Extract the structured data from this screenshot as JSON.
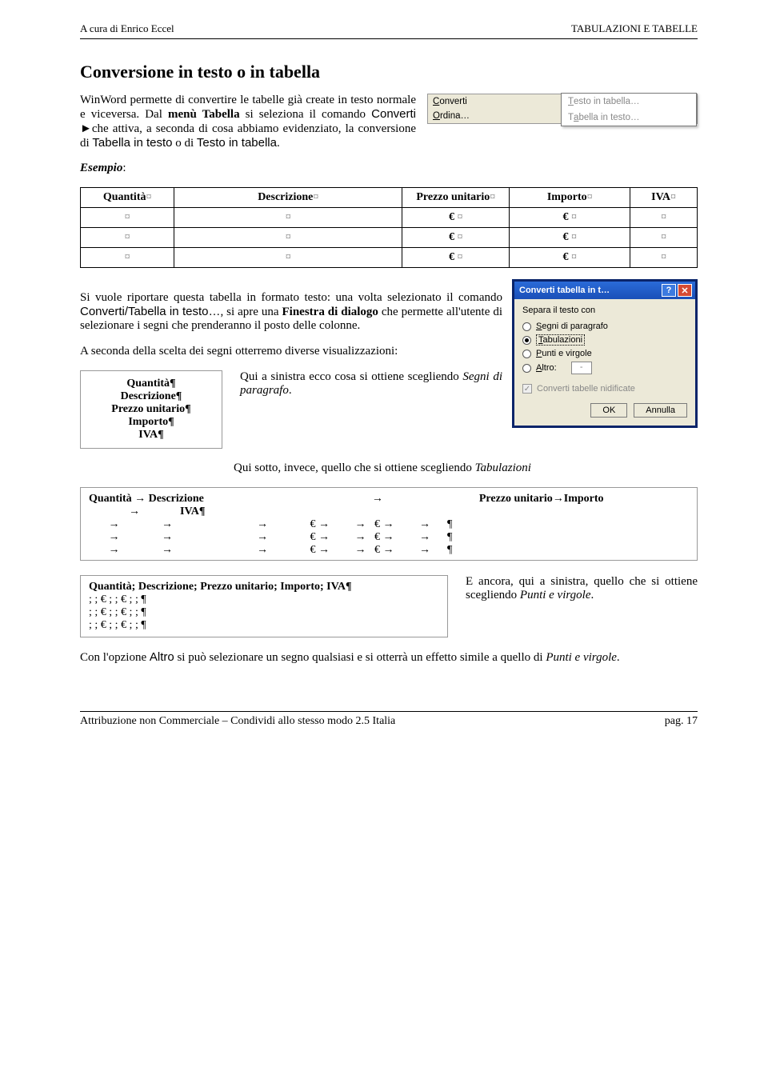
{
  "header": {
    "left": "A cura di Enrico Eccel",
    "right": "TABULAZIONI E TABELLE"
  },
  "title": "Conversione in testo o in tabella",
  "intro": {
    "p1a": "WinWord permette di convertire le tabelle già create in testo normale e viceversa. Dal ",
    "p1b": "menù Tabella",
    "p1c": " si seleziona il comando ",
    "p1d": "Converti ►",
    "p1e": "che attiva, a seconda di cosa abbiamo evidenziato, la conversione di ",
    "p1f": "Tabella in testo",
    "p1g": " o di ",
    "p1h": "Testo in tabella",
    "p1i": "."
  },
  "menu": {
    "converti": "Converti",
    "ordina": "Ordina…",
    "sub1": "Testo in tabella…",
    "sub2": "Tabella in testo…"
  },
  "esempio_label": "Esempio",
  "table": {
    "headers": [
      "Quantità",
      "Descrizione",
      "Prezzo unitario",
      "Importo",
      "IVA"
    ],
    "euro": "€",
    "mark": "¤"
  },
  "para2a": "Si vuole riportare questa tabella in formato testo: una volta selezionato il comando ",
  "para2b": "Converti/Tabella in testo…",
  "para2c": ", si apre una ",
  "para2d": "Finestra di dialogo",
  "para2e": " che permette all'utente di selezionare i segni che prenderanno il posto delle colonne.",
  "para3": "A seconda della scelta dei segni otterremo diverse visualizzazioni:",
  "dialog": {
    "title": "Converti tabella in t…",
    "section": "Separa il testo con",
    "opt1": "Segni di paragrafo",
    "opt2": "Tabulazioni",
    "opt3": "Punti e virgole",
    "opt4": "Altro:",
    "altro_value": "-",
    "check": "Converti tabelle nidificate",
    "ok": "OK",
    "cancel": "Annulla"
  },
  "paragraph_box_lines": [
    "Quantità¶",
    "Descrizione¶",
    "Prezzo unitario¶",
    "Importo¶",
    "IVA¶"
  ],
  "note1a": "Qui a sinistra ecco cosa si ottiene scegliendo ",
  "note1b": "Segni di paragrafo",
  "note1c": ".",
  "note2a": "Qui sotto, invece, quello che si ottiene scegliendo ",
  "note2b": "Tabulazioni",
  "tabs_header1": "Quantità → Descrizione",
  "tabs_header2": "Prezzo unitario→Importo",
  "tabs_header3": "IVA¶",
  "tabs_arrow": "→",
  "tabs_data_segment": "€ →         →   € →         →      ¶",
  "semibox_header": "Quantità; Descrizione; Prezzo unitario; Importo; IVA¶",
  "semibox_line": "; ; € ; ; € ; ; ¶",
  "note3a": "E ancora, qui a sinistra, quello che si ottiene scegliendo ",
  "note3b": "Punti e virgole",
  "note3c": ".",
  "final1": "Con l'opzione ",
  "final2": "Altro",
  "final3": " si può selezionare un segno qualsiasi e si otterrà un effetto simile a quello di ",
  "final4": "Punti e virgole",
  "final5": ".",
  "footer": {
    "left": "Attribuzione non Commerciale – Condividi  allo stesso modo 2.5 Italia",
    "right": "pag. 17"
  }
}
